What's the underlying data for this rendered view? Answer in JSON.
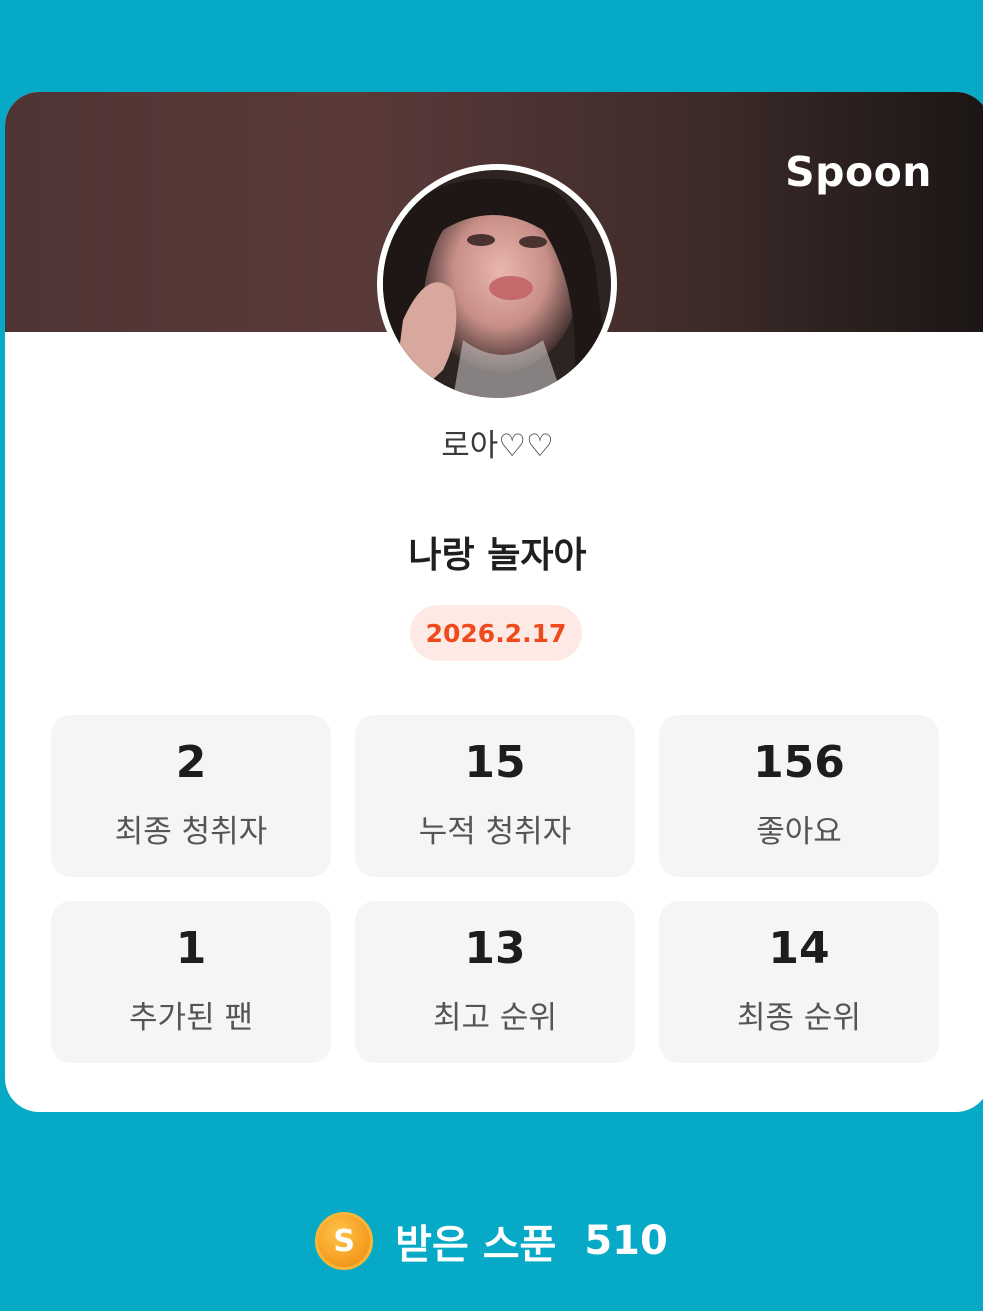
{
  "brand": {
    "name": "Spoon"
  },
  "profile": {
    "nickname": "로아♡♡",
    "title": "나랑 놀자아",
    "date": "2026.2.17"
  },
  "stats": [
    {
      "value": "2",
      "label": "최종 청취자"
    },
    {
      "value": "15",
      "label": "누적 청취자"
    },
    {
      "value": "156",
      "label": "좋아요"
    },
    {
      "value": "1",
      "label": "추가된 팬"
    },
    {
      "value": "13",
      "label": "최고 순위"
    },
    {
      "value": "14",
      "label": "최종 순위"
    }
  ],
  "footer": {
    "coin_letter": "S",
    "label": "받은 스푼",
    "count": "510"
  },
  "colors": {
    "background": "#06a9c6",
    "date_accent": "#ef4a1e",
    "coin": "#f49a1c"
  },
  "icons": {
    "coin": "spoon-coin-icon"
  }
}
